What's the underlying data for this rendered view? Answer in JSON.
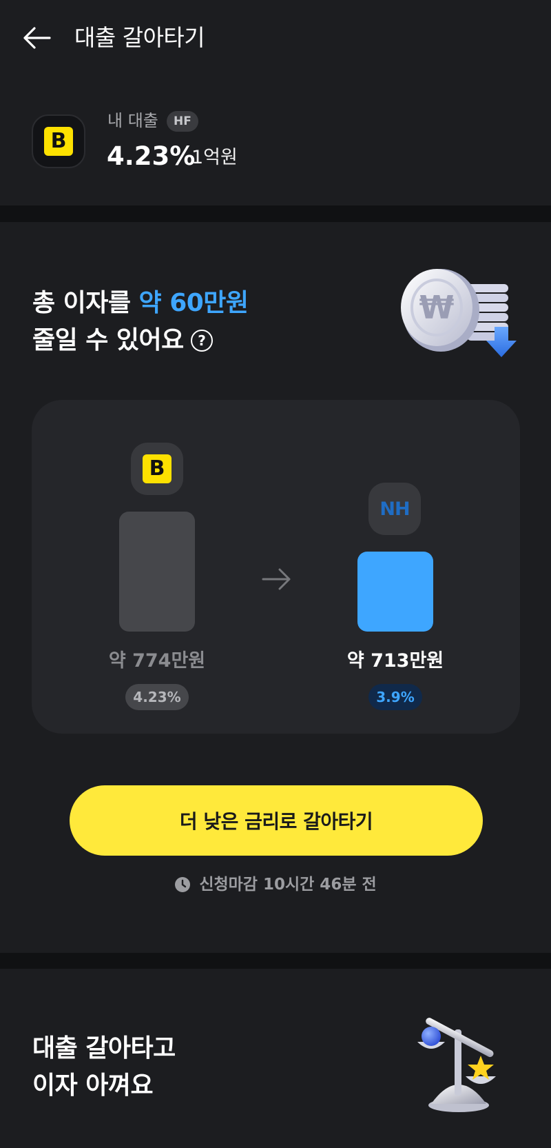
{
  "header": {
    "title": "대출 갈아타기",
    "back_icon": "arrow-left-icon"
  },
  "my_loan": {
    "label": "내 대출",
    "badge": "HF",
    "rate": "4.23%",
    "amount": "1억원",
    "bank_logo_letter": "B",
    "bank_logo_color": "#fde100"
  },
  "savings": {
    "headline_prefix": "총 이자를 ",
    "headline_highlight": "약 60만원",
    "headline_line2": "줄일 수 있어요",
    "help_icon": "?",
    "highlight_color": "#3ea6ff",
    "illustration_icon": "won-coin-stack-down-icon"
  },
  "comparison": {
    "current": {
      "bank_logo_letter": "B",
      "total_interest": "약 774만원",
      "rate": "4.23%",
      "value_manwon": 774
    },
    "new": {
      "bank_logo_text": "NH",
      "total_interest": "약 713만원",
      "rate": "3.9%",
      "value_manwon": 713
    },
    "arrow_icon": "arrow-right-icon"
  },
  "cta": {
    "label": "더 낮은 금리로 갈아타기",
    "color": "#ffe93b"
  },
  "deadline": {
    "icon": "clock-icon",
    "text": "신청마감 10시간 46분 전"
  },
  "promo": {
    "line1": "대출 갈아타고",
    "line2": "이자 아껴요",
    "illustration_icon": "balance-scale-icon"
  }
}
